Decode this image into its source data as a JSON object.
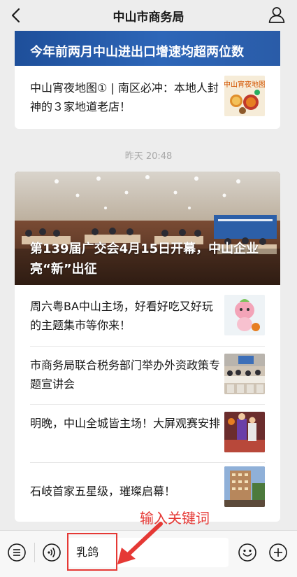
{
  "header": {
    "title": "中山市商务局"
  },
  "card1": {
    "banner_title": "今年前两月中山进出口增速均超两位数",
    "item": {
      "text": "中山宵夜地图① | 南区必冲：本地人封神的３家地道老店！",
      "thumb_caption": "中山宵夜地图"
    }
  },
  "timestamp": "昨天 20:48",
  "card2": {
    "hero_title": "第139届广交会4月15日开幕，中山企业亮“新”出征",
    "items": [
      {
        "text": "周六粤BA中山主场，好看好吃又好玩的主题集市等你来！"
      },
      {
        "text": "市商务局联合税务部门举办外资政策专题宣讲会"
      },
      {
        "text": "明晚，中山全城皆主场！大屏观赛安排"
      },
      {
        "text": "石岐首家五星级，璀璨启幕！"
      }
    ]
  },
  "bottombar": {
    "input_value": "乳鸽"
  },
  "annotation": {
    "text": "输入关键词",
    "color": "#e53935"
  },
  "icons": {
    "back": "chevron-left-icon",
    "profile": "person-icon",
    "menu": "list-menu-icon",
    "voice": "voice-icon",
    "emoji": "smiley-icon",
    "plus": "plus-icon"
  },
  "colors": {
    "background": "#ededed",
    "card": "#ffffff",
    "banner": "#2d66b8",
    "annotation": "#e53935"
  }
}
